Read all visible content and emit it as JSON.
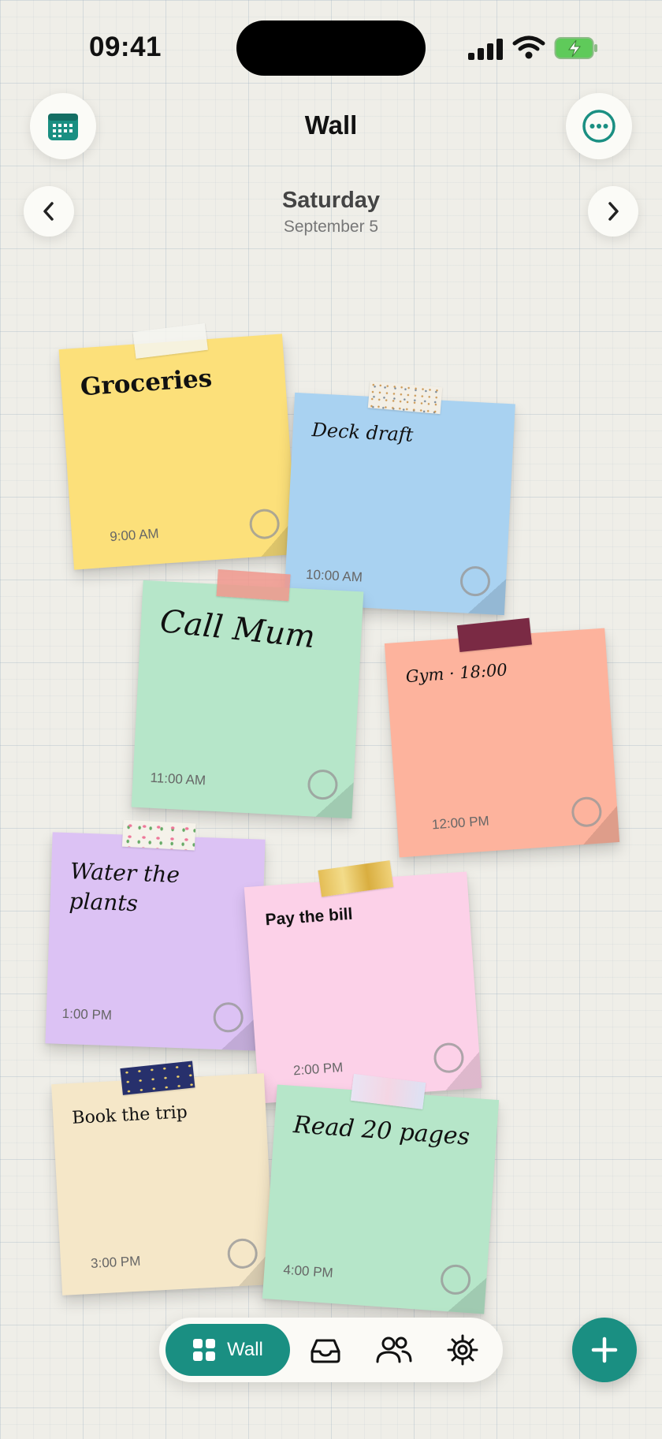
{
  "status": {
    "time": "09:41"
  },
  "header": {
    "title": "Wall"
  },
  "date": {
    "day": "Saturday",
    "date": "September 5"
  },
  "notes": [
    {
      "title": "Groceries",
      "time": "9:00 AM",
      "color": "#fce07a",
      "tape": "#eeeeee"
    },
    {
      "title": "Deck draft",
      "time": "10:00 AM",
      "color": "#a9d2f1",
      "tape": "#f3efe6"
    },
    {
      "title": "Call Mum",
      "time": "11:00 AM",
      "color": "#b6e6c9",
      "tape": "#f0a79f"
    },
    {
      "title": "Gym · 18:00",
      "time": "12:00 PM",
      "color": "#fdb39d",
      "tape": "#7a2a44"
    },
    {
      "title": "Water the plants",
      "time": "1:00 PM",
      "color": "#dcc2f4",
      "tape": "#f5f2ea"
    },
    {
      "title": "Pay the bill",
      "time": "2:00 PM",
      "color": "#fcd1e8",
      "tape": "#e6c25e"
    },
    {
      "title": "Book the trip",
      "time": "3:00 PM",
      "color": "#f5e7c8",
      "tape": "#27306c"
    },
    {
      "title": "Read 20 pages",
      "time": "4:00 PM",
      "color": "#b6e6c9",
      "tape": "#e4e0f2"
    }
  ],
  "nav": {
    "wall_label": "Wall"
  },
  "colors": {
    "accent": "#1a8f82"
  }
}
